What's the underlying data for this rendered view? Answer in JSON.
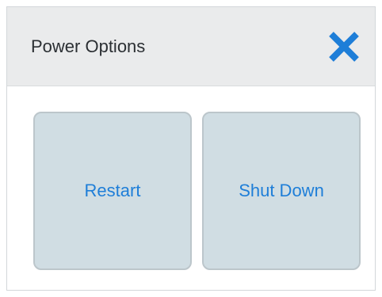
{
  "dialog": {
    "title": "Power Options",
    "close_icon": "close-icon",
    "accent_color": "#1e7ed8"
  },
  "options": {
    "restart_label": "Restart",
    "shutdown_label": "Shut Down"
  }
}
